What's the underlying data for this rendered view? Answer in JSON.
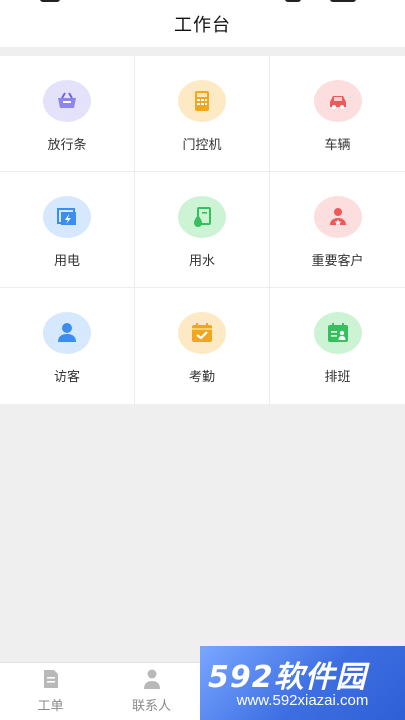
{
  "header": {
    "title": "工作台"
  },
  "grid": {
    "items": [
      {
        "label": "放行条",
        "icon": "basket-icon",
        "bg": "#e4e2fb",
        "color": "#6d63e6"
      },
      {
        "label": "门控机",
        "icon": "keypad-icon",
        "bg": "#fde9c4",
        "color": "#f0a61d"
      },
      {
        "label": "车辆",
        "icon": "car-icon",
        "bg": "#fddede",
        "color": "#ee5a5a"
      },
      {
        "label": "用电",
        "icon": "electricity-icon",
        "bg": "#d6e8fd",
        "color": "#3b8df0"
      },
      {
        "label": "用水",
        "icon": "water-icon",
        "bg": "#cdf3d5",
        "color": "#35bf5d"
      },
      {
        "label": "重要客户",
        "icon": "vip-customer-icon",
        "bg": "#fddede",
        "color": "#ee5a5a"
      },
      {
        "label": "访客",
        "icon": "visitor-icon",
        "bg": "#d6e8fd",
        "color": "#3b8df0"
      },
      {
        "label": "考勤",
        "icon": "attendance-icon",
        "bg": "#fde9c4",
        "color": "#f0a61d"
      },
      {
        "label": "排班",
        "icon": "schedule-icon",
        "bg": "#cdf3d5",
        "color": "#35bf5d"
      }
    ]
  },
  "tabbar": {
    "tabs": [
      {
        "label": "工单",
        "icon": "document-icon"
      },
      {
        "label": "联系人",
        "icon": "person-icon"
      }
    ]
  },
  "watermark": {
    "text": "592软件园",
    "url": "www.592xiazai.com"
  }
}
